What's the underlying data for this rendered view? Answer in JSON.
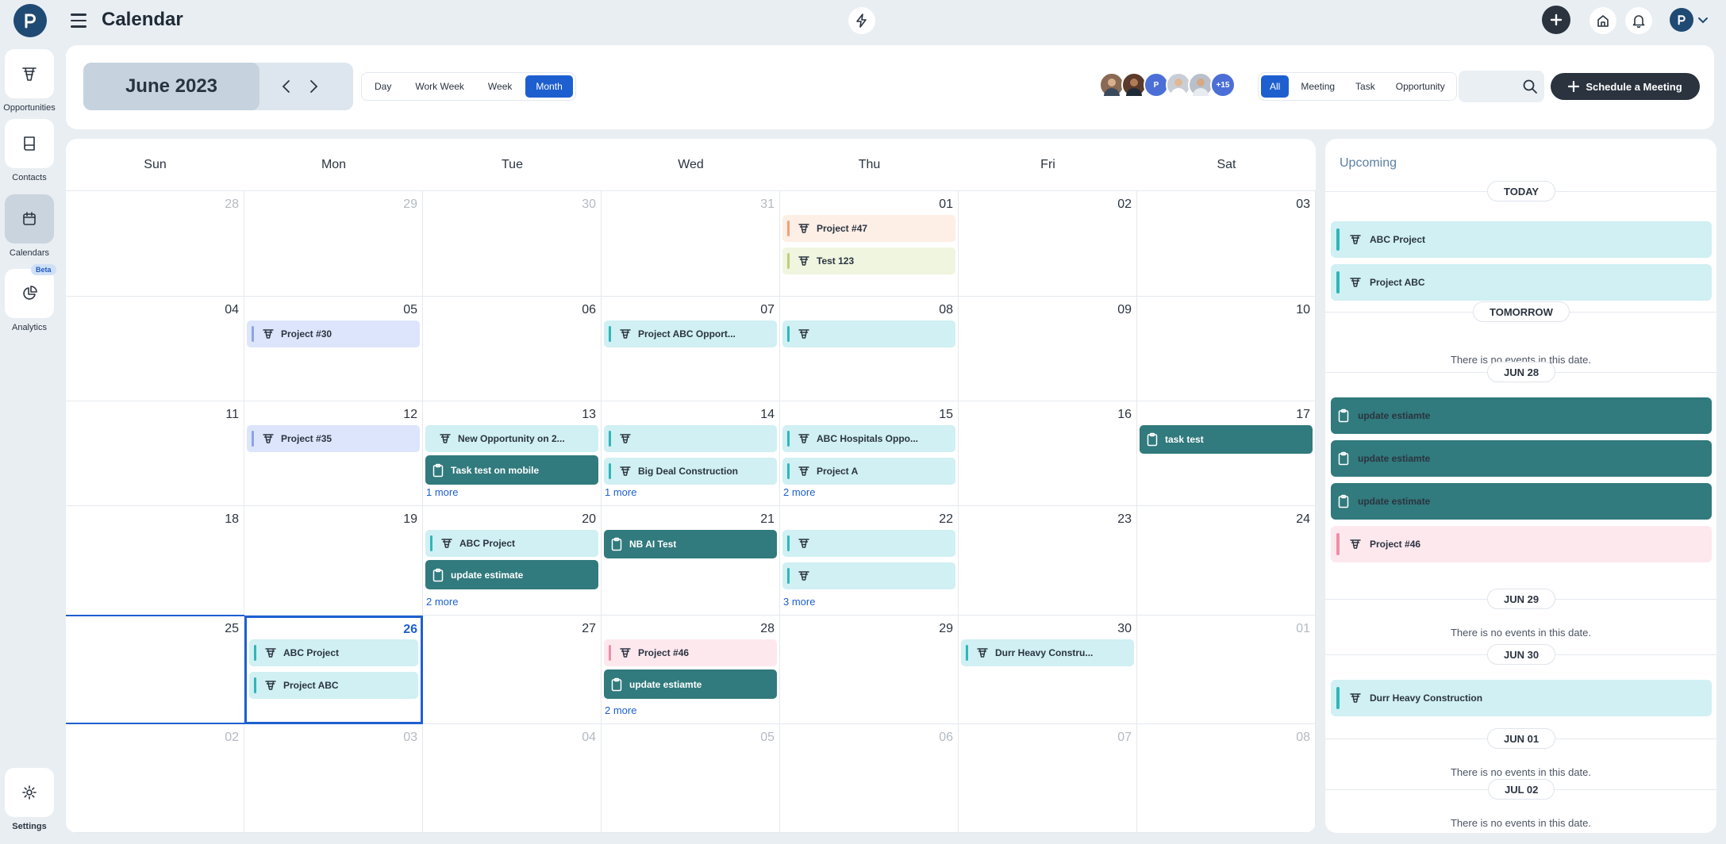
{
  "app": {
    "title": "Calendar"
  },
  "sidebar": {
    "items": [
      {
        "label": "Opportunities",
        "icon": "funnel-icon"
      },
      {
        "label": "Contacts",
        "icon": "book-icon"
      },
      {
        "label": "Calendars",
        "icon": "calendar-icon"
      },
      {
        "label": "Analytics",
        "icon": "pie-chart-icon",
        "badge": "Beta"
      }
    ],
    "settings_label": "Settings"
  },
  "toolbar": {
    "month_label": "June 2023",
    "views": [
      "Day",
      "Work Week",
      "Week",
      "Month"
    ],
    "active_view": "Month",
    "avatar_initial": "P",
    "avatar_more": "+15",
    "filters": [
      "All",
      "Meeting",
      "Task",
      "Opportunity"
    ],
    "active_filter": "All",
    "search_placeholder": "",
    "schedule_label": "Schedule a Meeting"
  },
  "calendar": {
    "weekdays": [
      "Sun",
      "Mon",
      "Tue",
      "Wed",
      "Thu",
      "Fri",
      "Sat"
    ],
    "weeks": [
      [
        {
          "day": "28",
          "other": true,
          "events": []
        },
        {
          "day": "29",
          "other": true,
          "events": []
        },
        {
          "day": "30",
          "other": true,
          "events": []
        },
        {
          "day": "31",
          "other": true,
          "events": []
        },
        {
          "day": "01",
          "events": [
            {
              "label": "Project #47",
              "kind": "peach"
            },
            {
              "label": "Test 123",
              "kind": "lime"
            }
          ]
        },
        {
          "day": "02",
          "events": []
        },
        {
          "day": "03",
          "events": []
        }
      ],
      [
        {
          "day": "04",
          "events": []
        },
        {
          "day": "05",
          "events": [
            {
              "label": "Project #30",
              "kind": "blue"
            }
          ]
        },
        {
          "day": "06",
          "events": []
        },
        {
          "day": "07",
          "events": [
            {
              "label": "Project ABC Opport...",
              "kind": "teal"
            }
          ]
        },
        {
          "day": "08",
          "events": [
            {
              "label": "",
              "kind": "teal"
            }
          ]
        },
        {
          "day": "09",
          "events": []
        },
        {
          "day": "10",
          "events": []
        }
      ],
      [
        {
          "day": "11",
          "events": []
        },
        {
          "day": "12",
          "events": [
            {
              "label": "Project #35",
              "kind": "blue"
            }
          ]
        },
        {
          "day": "13",
          "events": [
            {
              "label": "New Opportunity on 2...",
              "kind": "teal-nobar"
            },
            {
              "label": "Task test on mobile",
              "kind": "dark"
            }
          ],
          "more": "1 more"
        },
        {
          "day": "14",
          "events": [
            {
              "label": "",
              "kind": "teal"
            },
            {
              "label": "Big Deal Construction",
              "kind": "teal"
            }
          ],
          "more": "1 more"
        },
        {
          "day": "15",
          "events": [
            {
              "label": "ABC Hospitals Oppo...",
              "kind": "teal"
            },
            {
              "label": "Project A",
              "kind": "teal"
            }
          ],
          "more": "2 more"
        },
        {
          "day": "16",
          "events": []
        },
        {
          "day": "17",
          "events": [
            {
              "label": "task test",
              "kind": "dark"
            }
          ]
        }
      ],
      [
        {
          "day": "18",
          "events": []
        },
        {
          "day": "19",
          "events": []
        },
        {
          "day": "20",
          "events": [
            {
              "label": "ABC Project",
              "kind": "teal"
            },
            {
              "label": "update estimate",
              "kind": "dark"
            }
          ],
          "more": "2 more"
        },
        {
          "day": "21",
          "events": [
            {
              "label": "NB AI Test",
              "kind": "dark"
            }
          ]
        },
        {
          "day": "22",
          "events": [
            {
              "label": "",
              "kind": "teal"
            },
            {
              "label": "",
              "kind": "teal"
            }
          ],
          "more": "3 more"
        },
        {
          "day": "23",
          "events": []
        },
        {
          "day": "24",
          "events": []
        }
      ],
      [
        {
          "day": "25",
          "events": []
        },
        {
          "day": "26",
          "today": true,
          "events": [
            {
              "label": "ABC Project",
              "kind": "teal"
            },
            {
              "label": "Project ABC",
              "kind": "teal"
            }
          ]
        },
        {
          "day": "27",
          "events": []
        },
        {
          "day": "28",
          "events": [
            {
              "label": "Project #46",
              "kind": "pink"
            },
            {
              "label": "update estiamte",
              "kind": "dark"
            }
          ],
          "more": "2 more"
        },
        {
          "day": "29",
          "events": []
        },
        {
          "day": "30",
          "events": [
            {
              "label": "Durr Heavy Constru...",
              "kind": "teal"
            }
          ]
        },
        {
          "day": "01",
          "other": true,
          "events": []
        }
      ],
      [
        {
          "day": "02",
          "other": true,
          "events": []
        },
        {
          "day": "03",
          "other": true,
          "events": []
        },
        {
          "day": "04",
          "other": true,
          "events": []
        },
        {
          "day": "05",
          "other": true,
          "events": []
        },
        {
          "day": "06",
          "other": true,
          "events": []
        },
        {
          "day": "07",
          "other": true,
          "events": []
        },
        {
          "day": "08",
          "other": true,
          "events": []
        }
      ]
    ]
  },
  "upcoming": {
    "title": "Upcoming",
    "groups": [
      {
        "label": "TODAY",
        "events": [
          {
            "label": "ABC Project",
            "kind": "teal"
          },
          {
            "label": "Project ABC",
            "kind": "teal"
          }
        ]
      },
      {
        "label": "TOMORROW",
        "empty": "There is no events in this date."
      },
      {
        "label": "JUN 28",
        "events": [
          {
            "label": "update estiamte",
            "kind": "dark"
          },
          {
            "label": "update estiamte",
            "kind": "dark"
          },
          {
            "label": "update estimate",
            "kind": "dark"
          },
          {
            "label": "Project #46",
            "kind": "pink"
          }
        ]
      },
      {
        "label": "JUN 29",
        "empty": "There is no events in this date."
      },
      {
        "label": "JUN 30",
        "events": [
          {
            "label": "Durr Heavy Construction",
            "kind": "teal"
          }
        ]
      },
      {
        "label": "JUN 01",
        "empty": "There is no events in this date."
      },
      {
        "label": "JUL 02",
        "empty": "There is no events in this date."
      }
    ]
  },
  "colors": {
    "accent": "#1e5fd0",
    "dark_event": "#317a7d",
    "teal_event": "#d0f0f3",
    "brand": "#1f4a73"
  }
}
